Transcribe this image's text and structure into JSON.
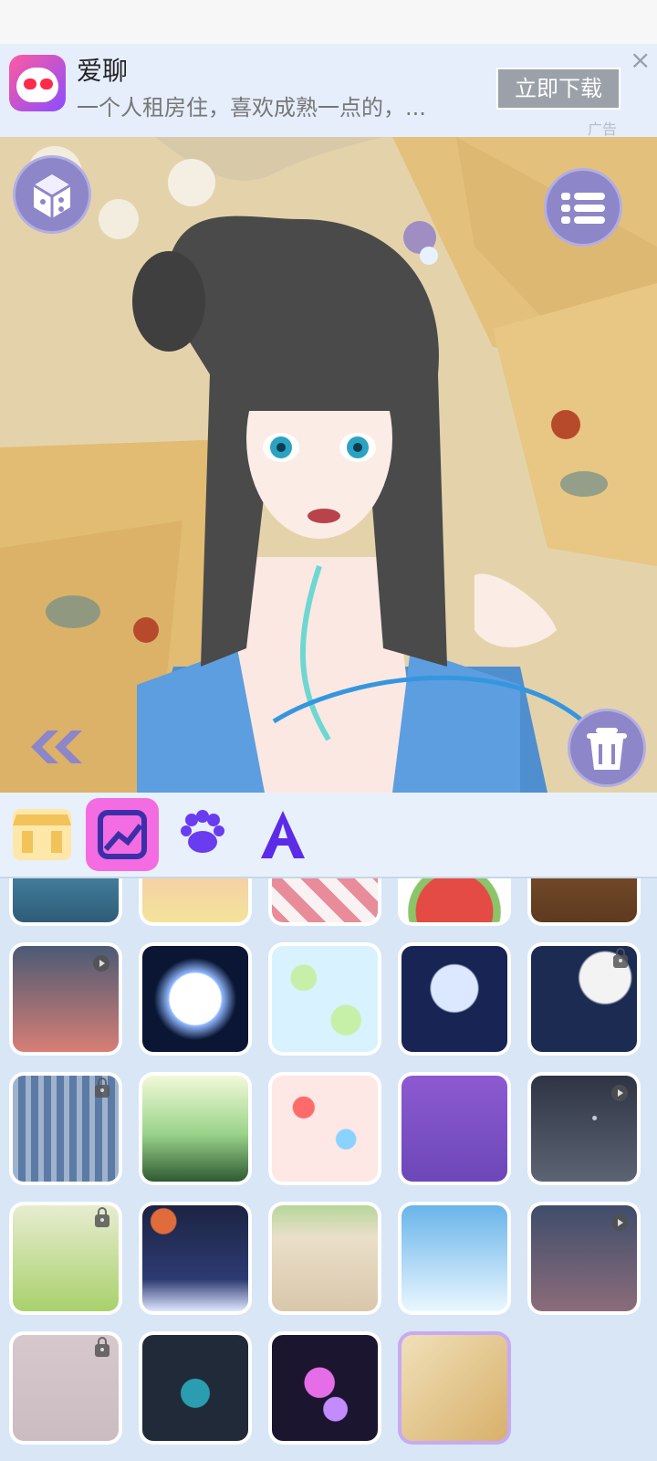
{
  "ad": {
    "app_name": "爱聊",
    "description": "一个人租房住，喜欢成熟一点的，...",
    "download_label": "立即下载",
    "close_label": "×",
    "ad_tag": "广告"
  },
  "stage": {
    "left_top_icon": "dice-icon",
    "right_top_icon": "menu-list-icon",
    "left_bottom_icon": "double-chevron-left-icon",
    "right_bottom_icon": "trash-icon"
  },
  "tabs": [
    {
      "name": "shop-icon",
      "active": false
    },
    {
      "name": "background-icon",
      "active": true
    },
    {
      "name": "paw-icon",
      "active": false
    },
    {
      "name": "text-icon",
      "active": false
    }
  ],
  "backgrounds": [
    {
      "name": "sea",
      "badge": "none"
    },
    {
      "name": "autumn-tree",
      "badge": "none"
    },
    {
      "name": "diamond-pattern",
      "badge": "none"
    },
    {
      "name": "watermelon",
      "badge": "none"
    },
    {
      "name": "wood",
      "badge": "none"
    },
    {
      "name": "dusk-sky",
      "badge": "play"
    },
    {
      "name": "full-moon-dark",
      "badge": "none"
    },
    {
      "name": "lotus-pond",
      "badge": "none"
    },
    {
      "name": "moon-clouds",
      "badge": "none"
    },
    {
      "name": "moon-stars",
      "badge": "lock"
    },
    {
      "name": "bamboo-rain",
      "badge": "lock"
    },
    {
      "name": "green-mountains",
      "badge": "none"
    },
    {
      "name": "patchwork",
      "badge": "none"
    },
    {
      "name": "purple-clouds",
      "badge": "none"
    },
    {
      "name": "spider-web",
      "badge": "play"
    },
    {
      "name": "green-waves",
      "badge": "lock"
    },
    {
      "name": "night-waves",
      "badge": "none"
    },
    {
      "name": "stone-wall",
      "badge": "none"
    },
    {
      "name": "sky-clouds",
      "badge": "none"
    },
    {
      "name": "night-sky",
      "badge": "play"
    },
    {
      "name": "pale-pattern",
      "badge": "lock"
    },
    {
      "name": "teal-splash",
      "badge": "none"
    },
    {
      "name": "pink-bubbles",
      "badge": "none"
    },
    {
      "name": "paper-fans",
      "badge": "none",
      "selected": true
    }
  ]
}
